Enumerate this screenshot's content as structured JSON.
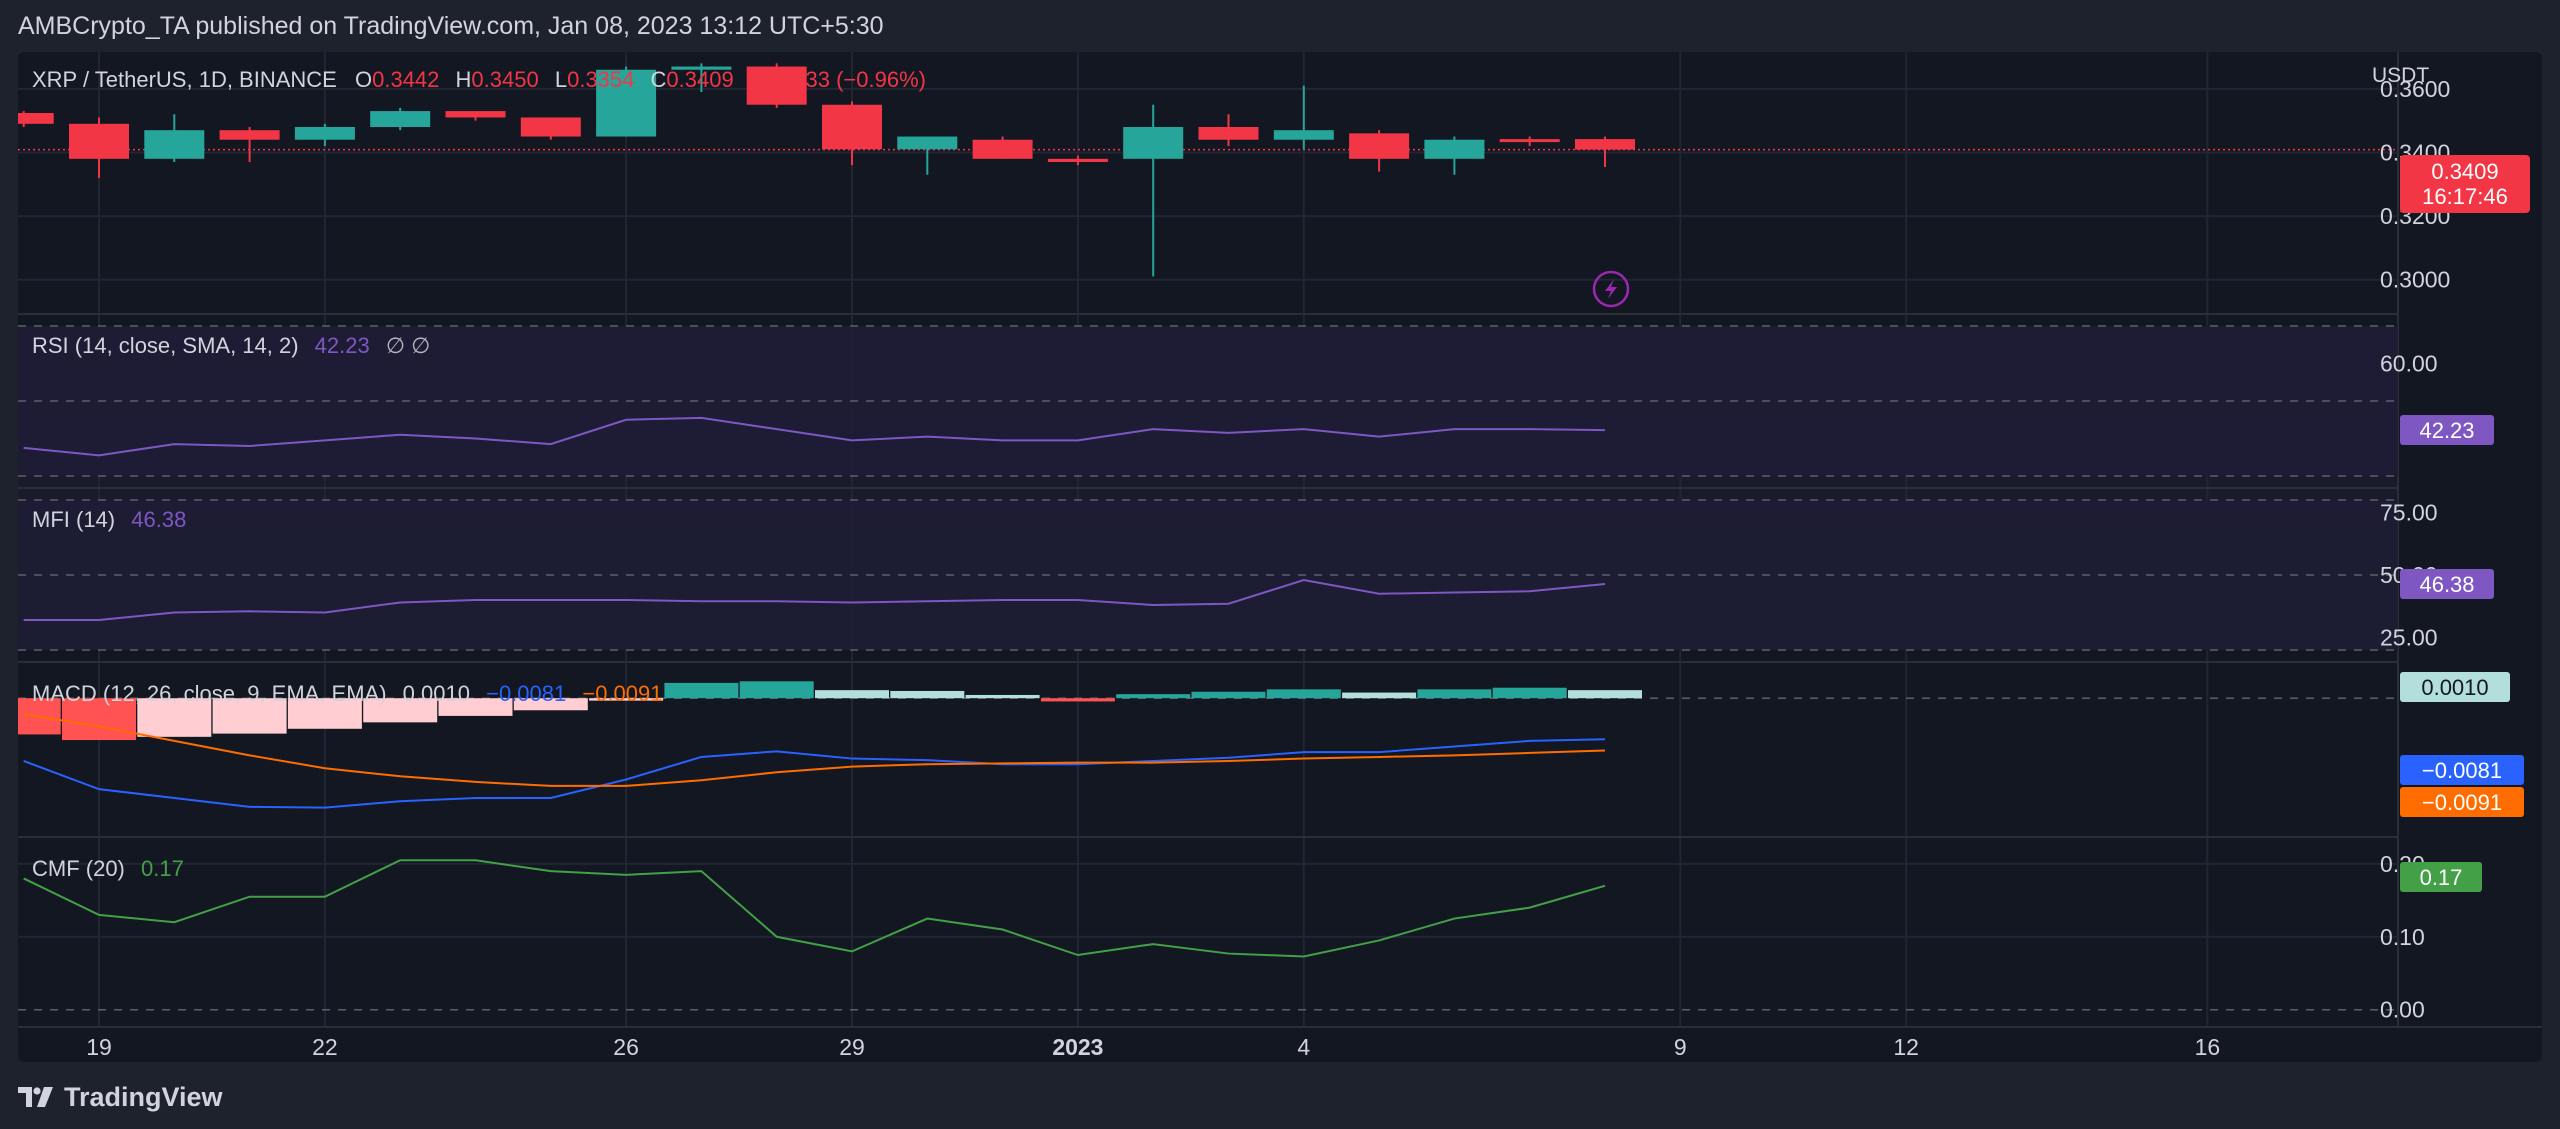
{
  "header": {
    "published_line": "AMBCrypto_TA published on TradingView.com, Jan 08, 2023 13:12 UTC+5:30"
  },
  "footer": {
    "brand": "TradingView"
  },
  "colors": {
    "bull": "#26a69a",
    "bear": "#f23645",
    "rsi": "#7e57c2",
    "mfi": "#7e57c2",
    "macd": "#2962ff",
    "signal": "#ff6d00",
    "cmf": "#43a047",
    "hist_pos_strong": "#26a69a",
    "hist_pos_weak": "#b2dfdb",
    "hist_neg_strong": "#ff5252",
    "hist_neg_weak": "#ffcdd2"
  },
  "legend": {
    "symbol": "XRP / TetherUS, 1D, BINANCE",
    "o_label": "O",
    "o_value": "0.3442",
    "h_label": "H",
    "h_value": "0.3450",
    "l_label": "L",
    "l_value": "0.3354",
    "c_label": "C",
    "c_value": "0.3409",
    "change": "−0.0033 (−0.96%)"
  },
  "price_axis": {
    "currency": "USDT",
    "ticks": [
      "0.3600",
      "0.3400",
      "0.3200",
      "0.3000"
    ],
    "last_price": "0.3409",
    "countdown": "16:17:46"
  },
  "rsi": {
    "label": "RSI (14, close, SMA, 14, 2)",
    "value": "42.23",
    "flags": "∅ ∅",
    "tick": "60.00",
    "badge": "42.23"
  },
  "mfi": {
    "label": "MFI (14)",
    "value": "46.38",
    "ticks": [
      "75.00",
      "50.00",
      "25.00"
    ],
    "badge": "46.38"
  },
  "macd": {
    "label": "MACD (12, 26, close, 9, EMA, EMA)",
    "hist_value": "0.0010",
    "macd_value": "−0.0081",
    "signal_value": "−0.0091",
    "badge_hist": "0.0010",
    "badge_macd": "−0.0081",
    "badge_signal": "−0.0091"
  },
  "cmf": {
    "label": "CMF (20)",
    "value": "0.17",
    "ticks": [
      "0.20",
      "0.10",
      "0.00"
    ],
    "badge": "0.17"
  },
  "time_axis": {
    "labels": [
      "19",
      "22",
      "26",
      "29",
      "2023",
      "4",
      "9",
      "12",
      "16"
    ]
  },
  "chart_data": {
    "type": "candlestick",
    "title": "XRP / TetherUS, 1D, BINANCE",
    "x_dates": [
      "2022-12-18",
      "2022-12-19",
      "2022-12-20",
      "2022-12-21",
      "2022-12-22",
      "2022-12-23",
      "2022-12-24",
      "2022-12-25",
      "2022-12-26",
      "2022-12-27",
      "2022-12-28",
      "2022-12-29",
      "2022-12-30",
      "2022-12-31",
      "2023-01-01",
      "2023-01-02",
      "2023-01-03",
      "2023-01-04",
      "2023-01-05",
      "2023-01-06",
      "2023-01-07",
      "2023-01-08"
    ],
    "ohlc": [
      [
        0.3524,
        0.353,
        0.348,
        0.349
      ],
      [
        0.349,
        0.351,
        0.332,
        0.338
      ],
      [
        0.338,
        0.352,
        0.337,
        0.347
      ],
      [
        0.347,
        0.348,
        0.337,
        0.344
      ],
      [
        0.344,
        0.349,
        0.342,
        0.348
      ],
      [
        0.348,
        0.354,
        0.347,
        0.353
      ],
      [
        0.353,
        0.353,
        0.35,
        0.351
      ],
      [
        0.351,
        0.351,
        0.344,
        0.345
      ],
      [
        0.345,
        0.367,
        0.345,
        0.366
      ],
      [
        0.366,
        0.368,
        0.359,
        0.367
      ],
      [
        0.367,
        0.368,
        0.354,
        0.355
      ],
      [
        0.355,
        0.356,
        0.336,
        0.341
      ],
      [
        0.341,
        0.345,
        0.333,
        0.345
      ],
      [
        0.344,
        0.345,
        0.338,
        0.338
      ],
      [
        0.338,
        0.339,
        0.336,
        0.337
      ],
      [
        0.338,
        0.355,
        0.301,
        0.348
      ],
      [
        0.348,
        0.352,
        0.342,
        0.344
      ],
      [
        0.344,
        0.361,
        0.341,
        0.347
      ],
      [
        0.346,
        0.347,
        0.334,
        0.338
      ],
      [
        0.338,
        0.345,
        0.333,
        0.344
      ],
      [
        0.3442,
        0.345,
        0.342,
        0.3435
      ],
      [
        0.3442,
        0.345,
        0.3354,
        0.3409
      ]
    ],
    "y_range": [
      0.293,
      0.37
    ],
    "rsi_values": [
      37.5,
      35.5,
      38.5,
      38,
      39.5,
      41,
      40,
      38.5,
      45,
      45.5,
      42.5,
      39.5,
      40.5,
      39.5,
      39.5,
      42.5,
      41.5,
      42.5,
      40.5,
      42.5,
      42.5,
      42.23
    ],
    "rsi_range": [
      30,
      70
    ],
    "mfi_values": [
      32,
      32,
      35,
      35.5,
      35,
      39,
      40,
      40,
      40,
      39.5,
      39.5,
      39,
      39.5,
      40,
      40,
      38,
      38.5,
      48,
      42.5,
      43,
      43.5,
      46.38
    ],
    "mfi_range": [
      20,
      80
    ],
    "macd_hist": [
      -0.0045,
      -0.0052,
      -0.0048,
      -0.0044,
      -0.0038,
      -0.003,
      -0.0022,
      -0.0015,
      -0.0003,
      0.0019,
      0.0021,
      0.001,
      0.0009,
      0.0004,
      -0.0004,
      0.0005,
      0.0008,
      0.0011,
      0.0007,
      0.0011,
      0.0013,
      0.001
    ],
    "macd_line": [
      -0.0078,
      -0.0113,
      -0.0124,
      -0.0135,
      -0.0136,
      -0.0128,
      -0.0124,
      -0.0124,
      -0.0101,
      -0.0073,
      -0.0066,
      -0.0075,
      -0.0077,
      -0.0082,
      -0.0082,
      -0.0078,
      -0.0074,
      -0.0067,
      -0.0067,
      -0.006,
      -0.0053,
      -0.0051
    ],
    "signal_line": [
      -0.002,
      -0.0035,
      -0.0053,
      -0.0071,
      -0.0087,
      -0.0097,
      -0.0104,
      -0.0109,
      -0.0109,
      -0.0102,
      -0.0092,
      -0.0085,
      -0.0082,
      -0.0081,
      -0.008,
      -0.008,
      -0.0078,
      -0.0075,
      -0.0073,
      -0.0071,
      -0.0068,
      -0.0065
    ],
    "macd_range": [
      -0.0165,
      0.004
    ],
    "cmf_values": [
      0.18,
      0.13,
      0.12,
      0.155,
      0.155,
      0.205,
      0.205,
      0.19,
      0.185,
      0.19,
      0.1,
      0.08,
      0.125,
      0.11,
      0.075,
      0.09,
      0.077,
      0.073,
      0.095,
      0.125,
      0.14,
      0.17
    ],
    "cmf_range": [
      -0.01,
      0.23
    ]
  }
}
